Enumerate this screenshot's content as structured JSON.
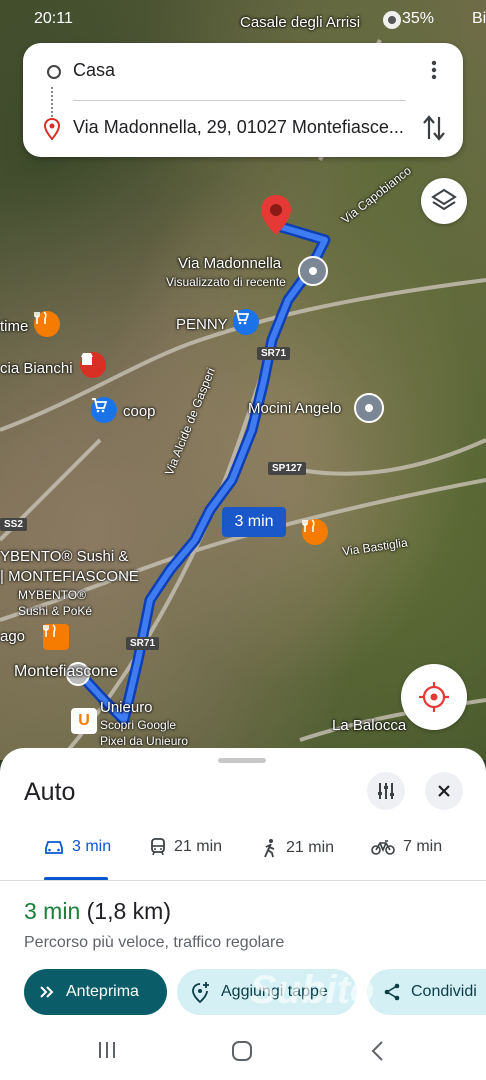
{
  "status_bar": {
    "time": "20:11",
    "battery": "35%",
    "overflow": "Bi"
  },
  "directions": {
    "origin": "Casa",
    "destination": "Via Madonnella, 29, 01027 Montefiasce..."
  },
  "map": {
    "labels": {
      "casale": "Casale degli Arrisi",
      "via_capobianco": "Via Capobianco",
      "via_madonnella": "Via Madonnella",
      "visualizzato": "Visualizzato di recente",
      "penny": "PENNY",
      "time_label": "time",
      "bianchi": "cia Bianchi",
      "coop": "coop",
      "mocini": "Mocini Angelo",
      "via_alcide": "Via Alcide de Gasperi",
      "sp127": "SP127",
      "sr71_top": "SR71",
      "sr71_bottom": "SR71",
      "ss2": "SS2",
      "via_bastiglia": "Via Bastiglia",
      "mybento1": "YBENTO® Sushi &",
      "mybento2": "| MONTEFIASCONE",
      "mybento3": "MYBENTO®",
      "mybento4": "Sushi & PoKé",
      "ago": "ago",
      "montefiascone": "Montefiascone",
      "unieuro": "Unieuro",
      "unieuro_sub1": "Scopri Google",
      "unieuro_sub2": "Pixel da Unieuro",
      "balocca": "La Balocca"
    },
    "route_time": "3 min"
  },
  "sheet": {
    "title": "Auto",
    "tabs": [
      {
        "icon": "car-icon",
        "label": "3 min"
      },
      {
        "icon": "transit-icon",
        "label": "21 min"
      },
      {
        "icon": "walk-icon",
        "label": "21 min"
      },
      {
        "icon": "bike-icon",
        "label": "7 min"
      }
    ],
    "duration": "3 min",
    "distance": "(1,8 km)",
    "description": "Percorso più veloce, traffico regolare",
    "buttons": {
      "preview": "Anteprima",
      "add_stops": "Aggiungi tappe",
      "share": "Condividi"
    }
  },
  "watermark": "Subito",
  "colors": {
    "route": "#1a57c9",
    "accent_green": "#188038",
    "primary_button": "#0a5d68"
  }
}
